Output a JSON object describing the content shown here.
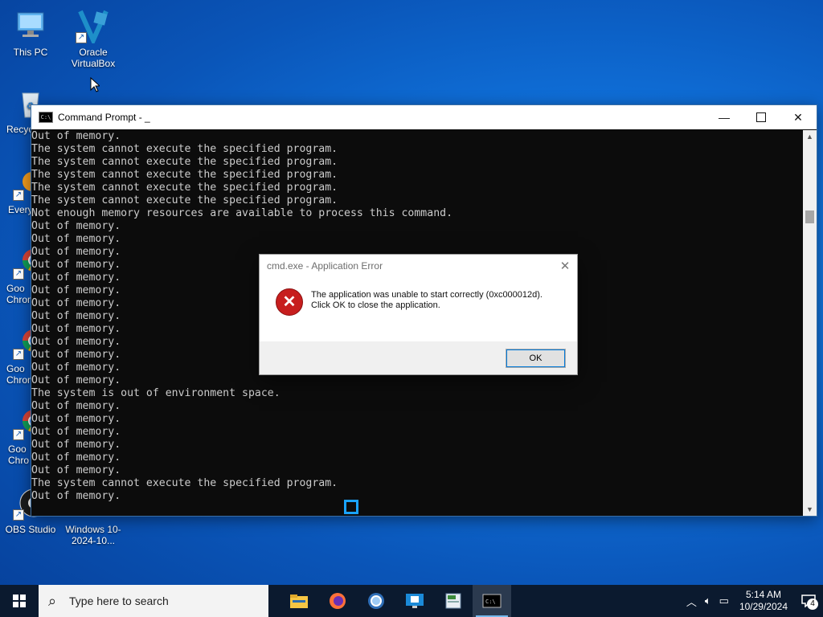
{
  "desktop": {
    "icons": [
      {
        "label": "This PC",
        "icon": "this-pc-icon"
      },
      {
        "label": "Oracle VirtualBox",
        "icon": "virtualbox-icon"
      },
      {
        "label": "Recyc",
        "icon": "recycle-bin-icon"
      },
      {
        "label": "Every",
        "icon": "everything-icon"
      },
      {
        "label": "Goo Chrom",
        "icon": "chrome-icon"
      },
      {
        "label": "Goo Chrom",
        "icon": "chrome-icon"
      },
      {
        "label": "Goo Chro",
        "icon": "chrome-icon"
      },
      {
        "label": "OBS Studio",
        "icon": "obs-icon"
      },
      {
        "label": "Windows 10-2024-10...",
        "icon": "file-icon"
      }
    ]
  },
  "cmd": {
    "title": "Command Prompt - _",
    "icon_text": "C:\\",
    "lines": [
      "Out of memory.",
      "The system cannot execute the specified program.",
      "The system cannot execute the specified program.",
      "The system cannot execute the specified program.",
      "The system cannot execute the specified program.",
      "The system cannot execute the specified program.",
      "Not enough memory resources are available to process this command.",
      "Out of memory.",
      "Out of memory.",
      "Out of memory.",
      "Out of memory.",
      "Out of memory.",
      "Out of memory.",
      "Out of memory.",
      "Out of memory.",
      "Out of memory.",
      "Out of memory.",
      "Out of memory.",
      "Out of memory.",
      "Out of memory.",
      "The system is out of environment space.",
      "Out of memory.",
      "Out of memory.",
      "Out of memory.",
      "Out of memory.",
      "Out of memory.",
      "Out of memory.",
      "The system cannot execute the specified program.",
      "Out of memory."
    ]
  },
  "dialog": {
    "title": "cmd.exe - Application Error",
    "message_line1": "The application was unable to start correctly (0xc000012d).",
    "message_line2": "Click OK to close the application.",
    "ok_label": "OK",
    "close_glyph": "✕"
  },
  "taskbar": {
    "search_placeholder": "Type here to search",
    "apps": [
      "file-explorer-icon",
      "firefox-icon",
      "chrome-icon",
      "remote-desktop-icon",
      "notepad-icon",
      "cmd-icon"
    ],
    "time": "5:14 AM",
    "date": "10/29/2024",
    "notification_count": "4"
  },
  "colors": {
    "accent": "#0078d7",
    "console_bg": "#0c0c0c",
    "console_text": "#cccccc",
    "error_red": "#c71e1e"
  }
}
